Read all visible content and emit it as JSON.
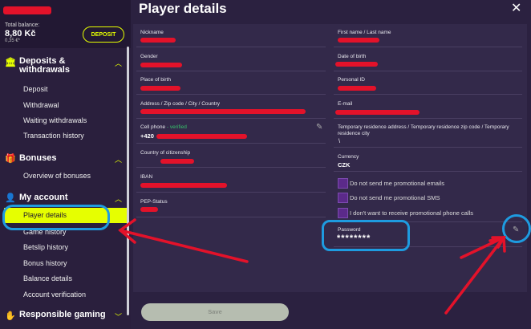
{
  "account": {
    "balance_label": "Total balance:",
    "balance_value": "8,80 Kč",
    "balance_sub": "0,35 €*",
    "deposit_label": "DEPOSIT"
  },
  "sidebar": {
    "deposits": {
      "title": "Deposits &\nwithdrawals",
      "items": [
        "Deposit",
        "Withdrawal",
        "Waiting withdrawals",
        "Transaction history"
      ]
    },
    "bonuses": {
      "title": "Bonuses",
      "items": [
        "Overview of bonuses"
      ]
    },
    "my_account": {
      "title": "My account",
      "items": [
        "Player details",
        "Game history",
        "Betslip history",
        "Bonus history",
        "Balance details",
        "Account verification"
      ]
    },
    "responsible": {
      "title": "Responsible gaming"
    }
  },
  "page": {
    "title": "Player details",
    "close_label": "✕"
  },
  "fields": {
    "nickname_label": "Nickname",
    "gender_label": "Gender",
    "place_of_birth_label": "Place of birth",
    "address_label": "Address / Zip code / City / Country",
    "cell_phone_label": "Cell phone",
    "verified_label": "- verified",
    "cell_phone_value": "+420",
    "citizenship_label": "Country of citizenship",
    "iban_label": "IBAN",
    "pep_label": "PEP-Status",
    "name_label": "First name / Last name",
    "dob_label": "Date of birth",
    "personal_id_label": "Personal ID",
    "email_label": "E-mail",
    "temp_address_label": "Temporary residence address / Temporary residence zip code / Temporary residence city",
    "temp_address_value": "\\",
    "currency_label": "Currency",
    "currency_value": "CZK"
  },
  "checkboxes": [
    "Do not send me promotional emails",
    "Do not send me promotional SMS",
    "I don't want to receive promotional phone calls"
  ],
  "password": {
    "label": "Password",
    "value": "********"
  },
  "save_label": "Save",
  "colors": {
    "accent": "#e6ff00",
    "annotation": "#1e9be0",
    "redaction": "#e3122a"
  },
  "icons": {
    "deposits": "bank-icon",
    "bonuses": "gift-icon",
    "account": "user-icon",
    "responsible": "hand-icon",
    "edit": "pencil-icon"
  }
}
